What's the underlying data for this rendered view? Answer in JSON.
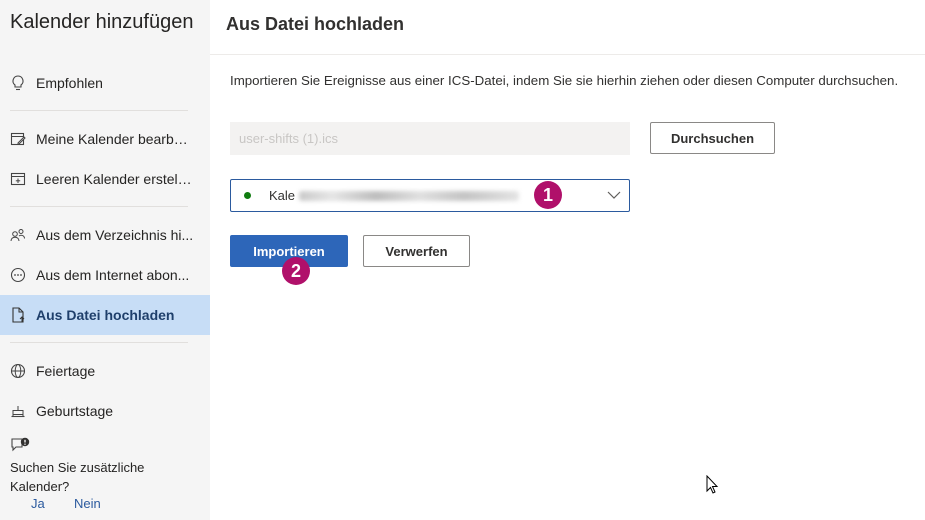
{
  "sidebar": {
    "title": "Kalender hinzufügen",
    "items": [
      {
        "label": "Empfohlen",
        "icon": "lightbulb-icon"
      },
      {
        "label": "Meine Kalender bearbei...",
        "icon": "edit-calendar-icon"
      },
      {
        "label": "Leeren Kalender erstellen",
        "icon": "calendar-add-icon"
      },
      {
        "label": "Aus dem Verzeichnis hi...",
        "icon": "people-icon"
      },
      {
        "label": "Aus dem Internet abon...",
        "icon": "globe-link-icon"
      },
      {
        "label": "Aus Datei hochladen",
        "icon": "file-upload-icon"
      },
      {
        "label": "Feiertage",
        "icon": "globe-icon"
      },
      {
        "label": "Geburtstage",
        "icon": "cake-icon"
      }
    ],
    "prompt": {
      "text": "Suchen Sie zusätzliche Kalender?",
      "yes": "Ja",
      "no": "Nein",
      "icon": "chat-alert-icon"
    }
  },
  "main": {
    "title": "Aus Datei hochladen",
    "description": "Importieren Sie Ereignisse aus einer ICS-Datei, indem Sie sie hierhin ziehen oder diesen Computer durchsuchen.",
    "file_value": "user-shifts (1).ics",
    "browse_label": "Durchsuchen",
    "calendar_select_value": "Kale",
    "calendar_dot_color": "#107c10",
    "import_label": "Importieren",
    "discard_label": "Verwerfen"
  },
  "annotations": {
    "badge1": "1",
    "badge2": "2",
    "badge_color": "#b0106a"
  },
  "colors": {
    "accent": "#2d66b9",
    "active_nav": "#c7ddf6"
  }
}
